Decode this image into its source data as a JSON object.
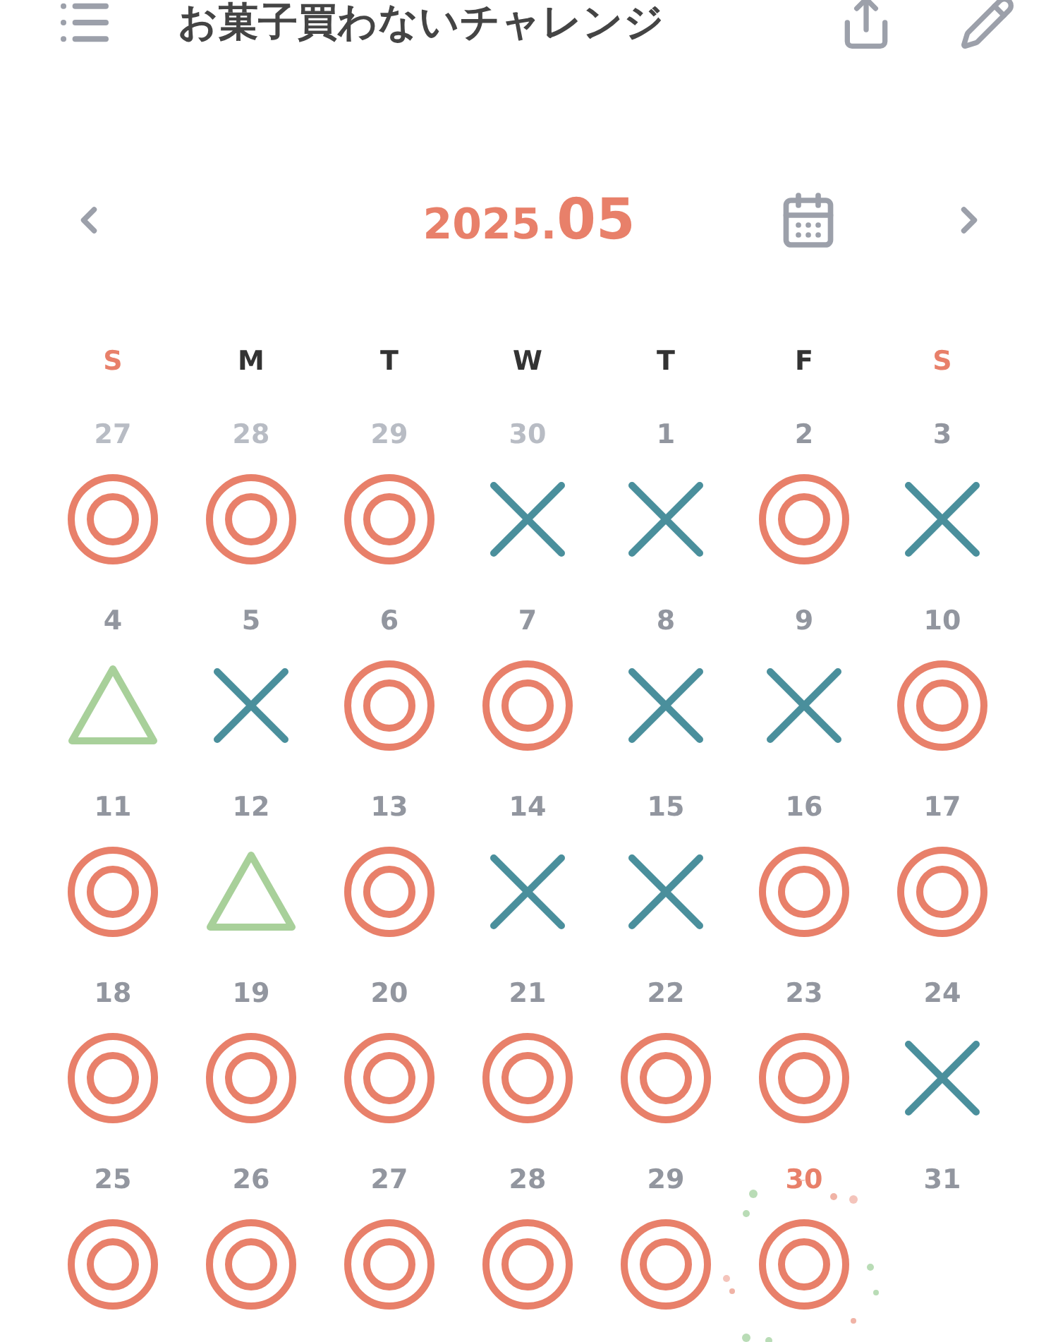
{
  "header": {
    "title": "お菓子買わないチャレンジ"
  },
  "month_nav": {
    "year": "2025.",
    "month": "05"
  },
  "weekdays": [
    {
      "label": "S",
      "weekend": true
    },
    {
      "label": "M",
      "weekend": false
    },
    {
      "label": "T",
      "weekend": false
    },
    {
      "label": "W",
      "weekend": false
    },
    {
      "label": "T",
      "weekend": false
    },
    {
      "label": "F",
      "weekend": false
    },
    {
      "label": "S",
      "weekend": true
    }
  ],
  "days": [
    {
      "day": "27",
      "muted": true,
      "today": false,
      "kind": "double-circle"
    },
    {
      "day": "28",
      "muted": true,
      "today": false,
      "kind": "double-circle"
    },
    {
      "day": "29",
      "muted": true,
      "today": false,
      "kind": "double-circle"
    },
    {
      "day": "30",
      "muted": true,
      "today": false,
      "kind": "cross"
    },
    {
      "day": "1",
      "muted": false,
      "today": false,
      "kind": "cross"
    },
    {
      "day": "2",
      "muted": false,
      "today": false,
      "kind": "double-circle"
    },
    {
      "day": "3",
      "muted": false,
      "today": false,
      "kind": "cross"
    },
    {
      "day": "4",
      "muted": false,
      "today": false,
      "kind": "triangle"
    },
    {
      "day": "5",
      "muted": false,
      "today": false,
      "kind": "cross"
    },
    {
      "day": "6",
      "muted": false,
      "today": false,
      "kind": "double-circle"
    },
    {
      "day": "7",
      "muted": false,
      "today": false,
      "kind": "double-circle"
    },
    {
      "day": "8",
      "muted": false,
      "today": false,
      "kind": "cross"
    },
    {
      "day": "9",
      "muted": false,
      "today": false,
      "kind": "cross"
    },
    {
      "day": "10",
      "muted": false,
      "today": false,
      "kind": "double-circle"
    },
    {
      "day": "11",
      "muted": false,
      "today": false,
      "kind": "double-circle"
    },
    {
      "day": "12",
      "muted": false,
      "today": false,
      "kind": "triangle"
    },
    {
      "day": "13",
      "muted": false,
      "today": false,
      "kind": "double-circle"
    },
    {
      "day": "14",
      "muted": false,
      "today": false,
      "kind": "cross"
    },
    {
      "day": "15",
      "muted": false,
      "today": false,
      "kind": "cross"
    },
    {
      "day": "16",
      "muted": false,
      "today": false,
      "kind": "double-circle"
    },
    {
      "day": "17",
      "muted": false,
      "today": false,
      "kind": "double-circle"
    },
    {
      "day": "18",
      "muted": false,
      "today": false,
      "kind": "double-circle"
    },
    {
      "day": "19",
      "muted": false,
      "today": false,
      "kind": "double-circle"
    },
    {
      "day": "20",
      "muted": false,
      "today": false,
      "kind": "double-circle"
    },
    {
      "day": "21",
      "muted": false,
      "today": false,
      "kind": "double-circle"
    },
    {
      "day": "22",
      "muted": false,
      "today": false,
      "kind": "double-circle"
    },
    {
      "day": "23",
      "muted": false,
      "today": false,
      "kind": "double-circle"
    },
    {
      "day": "24",
      "muted": false,
      "today": false,
      "kind": "cross"
    },
    {
      "day": "25",
      "muted": false,
      "today": false,
      "kind": "double-circle"
    },
    {
      "day": "26",
      "muted": false,
      "today": false,
      "kind": "double-circle"
    },
    {
      "day": "27",
      "muted": false,
      "today": false,
      "kind": "double-circle"
    },
    {
      "day": "28",
      "muted": false,
      "today": false,
      "kind": "double-circle"
    },
    {
      "day": "29",
      "muted": false,
      "today": false,
      "kind": "double-circle"
    },
    {
      "day": "30",
      "muted": false,
      "today": true,
      "kind": "double-circle"
    },
    {
      "day": "31",
      "muted": false,
      "today": false,
      "kind": "none"
    }
  ]
}
